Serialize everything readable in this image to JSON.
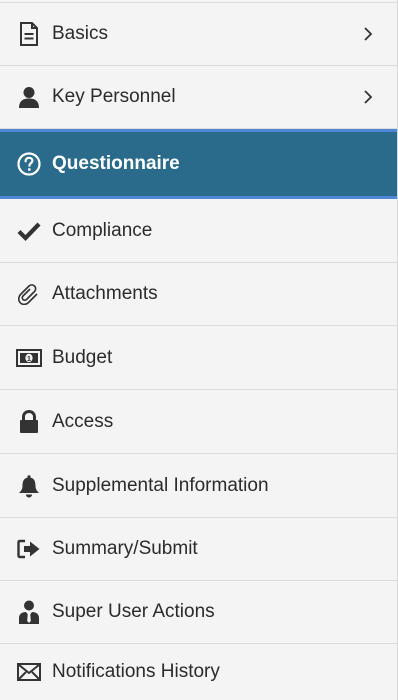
{
  "sidebar": {
    "items": [
      {
        "label": "Basics",
        "icon": "document-icon",
        "has_chevron": true
      },
      {
        "label": "Key Personnel",
        "icon": "person-icon",
        "has_chevron": true
      },
      {
        "label": "Questionnaire",
        "icon": "question-circle-icon",
        "active": true
      },
      {
        "label": "Compliance",
        "icon": "checkmark-icon"
      },
      {
        "label": "Attachments",
        "icon": "paperclip-icon"
      },
      {
        "label": "Budget",
        "icon": "money-icon"
      },
      {
        "label": "Access",
        "icon": "lock-icon"
      },
      {
        "label": "Supplemental Information",
        "icon": "bell-icon"
      },
      {
        "label": "Summary/Submit",
        "icon": "sign-out-icon"
      },
      {
        "label": "Super User Actions",
        "icon": "user-tie-icon"
      },
      {
        "label": "Notifications History",
        "icon": "envelope-icon"
      }
    ],
    "colors": {
      "active_background": "#2a6b8c",
      "active_border": "#4f86d6",
      "background": "#f4f4f4",
      "text": "#2b2b2b"
    }
  }
}
